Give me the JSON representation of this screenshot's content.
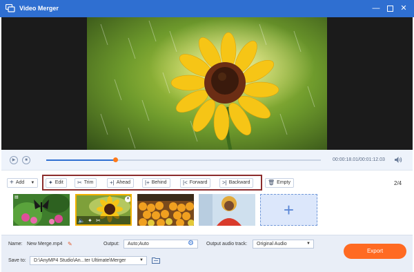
{
  "window": {
    "title": "Video Merger",
    "icon": "video-merger-app-icon",
    "controls": [
      "minimize-icon",
      "maximize-icon",
      "close-icon"
    ]
  },
  "player": {
    "current_time": "00:00:18.01",
    "total_time": "00:01:12.03",
    "time_separator": "/",
    "progress": 0.25,
    "icons": [
      "play-icon",
      "stop-icon",
      "volume-icon"
    ]
  },
  "toolbar": {
    "add_label": "Add",
    "edit_label": "Edit",
    "trim_label": "Trim",
    "ahead_label": "Ahead",
    "behind_label": "Behind",
    "forward_label": "Forward",
    "backward_label": "Backward",
    "empty_label": "Empty",
    "page_counter": "2/4",
    "accent": "#8b2c2c"
  },
  "clips": {
    "count": 4,
    "selected_index": 1,
    "selection_color": "#f2b100"
  },
  "bottom": {
    "name_label": "Name:",
    "name_value": "New Merge.mp4",
    "output_label": "Output:",
    "output_value": "Auto;Auto",
    "audio_label": "Output audio track:",
    "audio_value": "Original Audio",
    "save_label": "Save to:",
    "save_value": "D:\\AnyMP4 Studio\\An...ter Ultimate\\Merger",
    "export_label": "Export"
  },
  "colors": {
    "titlebar": "#2f6fd1",
    "export": "#ff6a22",
    "progress_thumb": "#ff7a1a"
  }
}
